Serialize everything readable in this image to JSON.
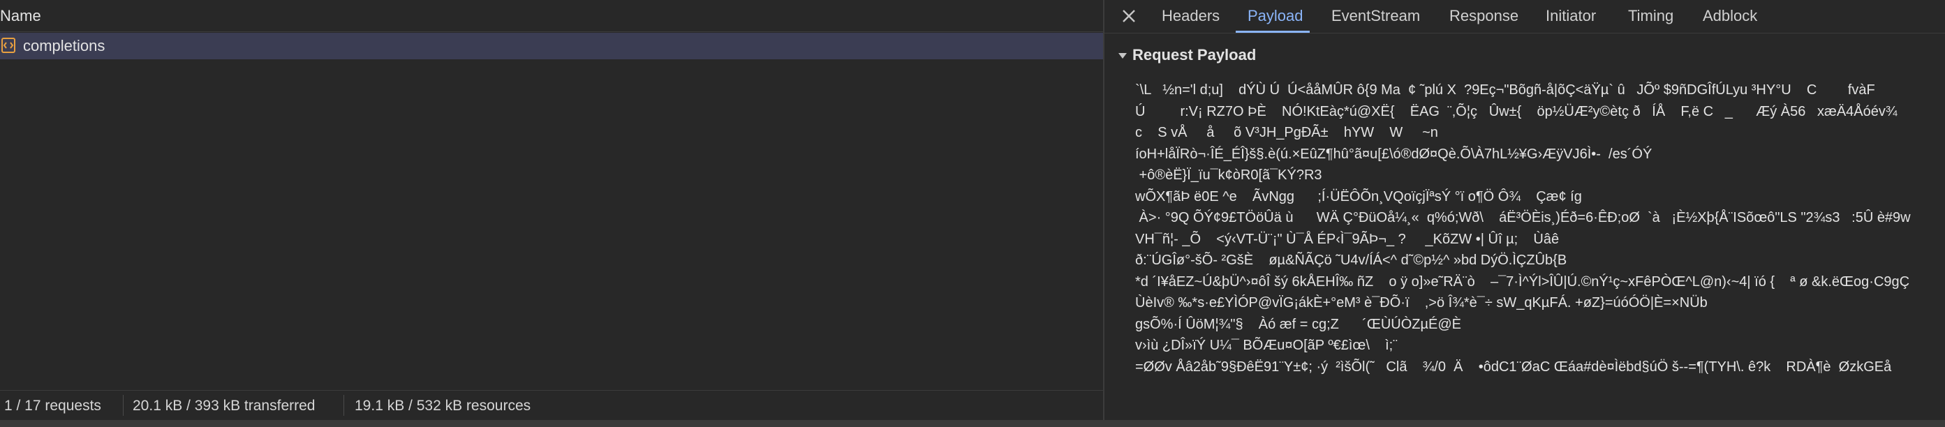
{
  "network_list": {
    "column_name": "Name",
    "requests": [
      {
        "name": "completions",
        "selected": true
      }
    ]
  },
  "status_bar": {
    "requests": "1 / 17 requests",
    "transferred": "20.1 kB / 393 kB transferred",
    "resources": "19.1 kB / 532 kB resources"
  },
  "details": {
    "tabs": [
      {
        "label": "Headers",
        "active": false
      },
      {
        "label": "Payload",
        "active": true
      },
      {
        "label": "EventStream",
        "active": false
      },
      {
        "label": "Response",
        "active": false
      },
      {
        "label": "Initiator",
        "active": false
      },
      {
        "label": "Timing",
        "active": false
      },
      {
        "label": "Adblock",
        "active": false
      }
    ],
    "section_title": "Request Payload",
    "payload_lines": [
      "`\\L   ½n='l d;u]    dÝÙ Ú  Ú<ååMÛR ô{9 Ma  ¢ ˜plú X  ?9Eç¬\"Bõgñ-å|õÇ<äŸµ` û   JÕº $9ñDGÎfÚLyu ³HY°U    C        fvàF",
      "Ú         r:V¡ RZ7O ÞÈ    NÓ!KtEàç*ú@XË{    ËAG  ¨,Õ¦ç   Ûw±{    öp½ÜÆ²y©ètç ð   ÍÅ    F,ë C   _      Æý À56   xæÄ4Åóév¾",
      "c    S vÅ     å     õ V³JH_PgÐÃ±    hYW    W     ~n",
      "íoH+låÏRò¬·ÎÉ_ÉÎ}š§.è(ú.×EûZ¶hû°ã¤u[£\\ó®dØ¤Qè.Õ\\À7hL½¥G›ÆÿVJ6Ì•-  /es´ÓÝ",
      " +ô®èË}Ï_ïu¯k¢òR0[ã¯KÝ?R3",
      "wÕX¶ãÞ ë0E ^e    ÃvNgg      ;Í·ÜËÔÕn¸VQoïçjÏªsÝ °ï o¶Ö Ô¾    Çæ¢ íg",
      " À>· °9Q ÕÝ¢9£TÖöÛä ù      WÄ Ç°ÐüOå¼¸«  q%ó;Wð\\    áË³ÖÈis¸)Éð=6·ÊÐ;oØ  `à   ¡È½Xþ{Å¨ISõœô\"LS \"2¾s3   :5Û è#9w",
      "VH¯ñ¦- _Õ    <ý‹VT-Ü¨¡\" Ù¯Å ÉP‹Ì¯9ÃÞ¬_ ?     _KõZW •| Ûî µ;    Ùâê",
      "ð:¨ÚGÎø°-šÕ- ²GšÈ    øµ&ÑÃÇö ˜U4v/ÍÁ<^ d˜©p½^ »bd DýÖ.ÌÇZÛb{B",
      "*d ´I¥åEZ~Ú&þÜ^›¤ôÎ šý 6kÅEHÎ‰ ñZ    o ÿ o]»e˜RÄ¨ò    –¯7·Ì^Ýl>ÎÛ|Ú.©nÝ¹ç~xFêPÒŒ^L@n)‹~4| ïó {    ª ø &k.ëŒog·C9gÇ",
      "ÙèIv® ‰*s·e£YÌÓP@vÏG¡ákÈ+°eM³ è¯ÐÕ·ï    ,>ö Î¾*è¯÷ sW_qKµFÁ. +øZ}=úóÓÖ|È=×NÜb",
      "gsÕ%·Í ÛöM¦¾\"§    Àó æf = cg;Z      ´ŒÙÚÒZµÉ@È",
      "v›ìù ¿DÎ»ïÝ U¼¯ BÕÆu¤O[ãP º€£ìœ\\    ì;¨",
      "=ØØv Åâ2åb˜9§ÐêË91¨Y±¢; ·ý  ²ìšÕl(˜   Clã    ¾/0  Ä    •ôdC1¨ØaC Œáa#dè¤Ìëbd§úÖ š--=¶(TYH\\. ê?k    RDÀ¶è  ØzkGEå"
    ]
  }
}
